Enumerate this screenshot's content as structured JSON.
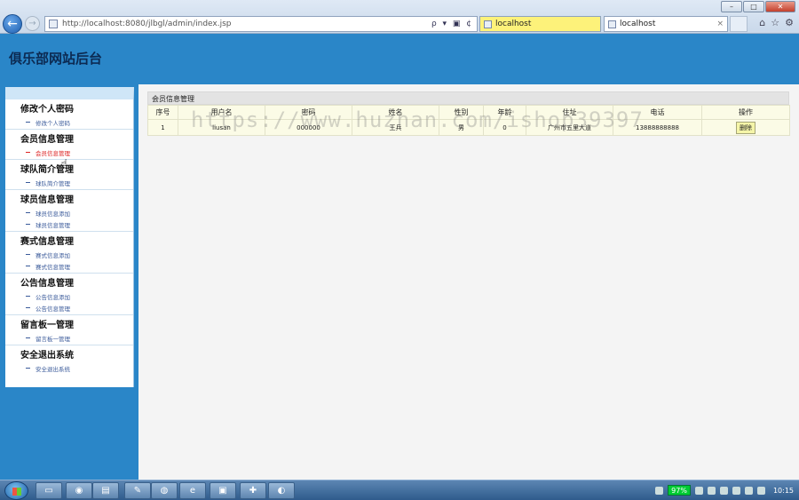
{
  "browser": {
    "url": "http://localhost:8080/jlbgl/admin/index.jsp",
    "address_tools": "ρ ▾ ▣ ¢",
    "tabs": [
      {
        "label": "localhost"
      },
      {
        "label": "localhost",
        "close": "×"
      }
    ],
    "window_controls": {
      "minimize": "–",
      "maximize": "□",
      "close": "✕"
    },
    "back_glyph": "←",
    "forward_glyph": "→",
    "chrome_icons": [
      "⌂",
      "☆",
      "⚙"
    ]
  },
  "site": {
    "title": "俱乐部网站后台"
  },
  "sidebar": {
    "groups": [
      {
        "title": "修改个人密码",
        "items": [
          {
            "label": "修改个人密码"
          }
        ]
      },
      {
        "title": "会员信息管理",
        "items": [
          {
            "label": "会员信息管理"
          }
        ]
      },
      {
        "title": "球队简介管理",
        "items": [
          {
            "label": "球队简介管理"
          }
        ]
      },
      {
        "title": "球员信息管理",
        "items": [
          {
            "label": "球员信息添加"
          },
          {
            "label": "球员信息管理"
          }
        ]
      },
      {
        "title": "赛式信息管理",
        "items": [
          {
            "label": "赛式信息添加"
          },
          {
            "label": "赛式信息管理"
          }
        ]
      },
      {
        "title": "公告信息管理",
        "items": [
          {
            "label": "公告信息添加"
          },
          {
            "label": "公告信息管理"
          }
        ]
      },
      {
        "title": "留言板一管理",
        "items": [
          {
            "label": "留言板一管理"
          }
        ]
      },
      {
        "title": "安全退出系统",
        "items": [
          {
            "label": "安全退出系统"
          }
        ]
      }
    ]
  },
  "main": {
    "caption": "会员信息管理",
    "columns": [
      "序号",
      "用户名",
      "密码",
      "姓名",
      "性别",
      "年龄",
      "住址",
      "电话",
      "操作"
    ],
    "rows": [
      {
        "id": "1",
        "username": "liusan",
        "password": "000000",
        "name": "王兵",
        "gender": "男",
        "age": "0",
        "address": "广州市五里大道",
        "phone": "13888888888",
        "action": "删除"
      }
    ]
  },
  "watermark": "https://www.huzhan.com/ishop39397",
  "taskbar": {
    "buttons": [
      "▭",
      "◉",
      "▤",
      "✎",
      "◍",
      "e",
      "▣",
      "✚",
      "◐"
    ],
    "battery": "97%",
    "clock": "10:15"
  }
}
